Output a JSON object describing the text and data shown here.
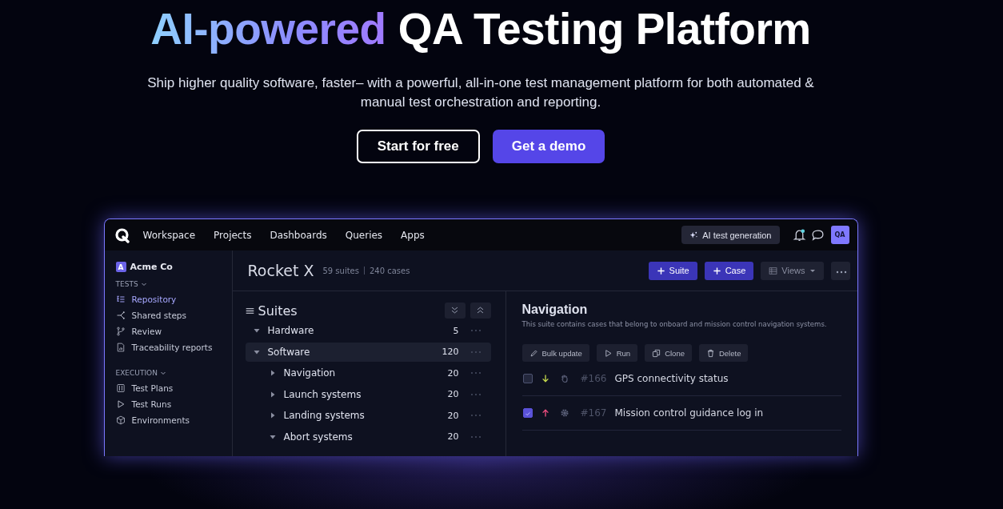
{
  "hero": {
    "title": [
      {
        "text": "AI-powered",
        "kind": "gradient"
      },
      {
        "text": "QA Testing Platform",
        "kind": "plain"
      }
    ],
    "subtitle": "Ship higher quality software, faster– with a powerful, all-in-one test management platform for both automated & manual test orchestration and reporting.",
    "buttons": [
      {
        "label": "Start for free",
        "kind": "outline"
      },
      {
        "label": "Get a demo",
        "kind": "primary"
      }
    ]
  },
  "app": {
    "nav": [
      "Workspace",
      "Projects",
      "Dashboards",
      "Queries",
      "Apps"
    ],
    "ai_button": "AI test generation",
    "notification": true,
    "avatar": "QA",
    "workspace": {
      "badge": "A",
      "name": "Acme Co"
    },
    "sidebar": [
      {
        "title": "TESTS",
        "expanded": true,
        "items": [
          {
            "label": "Repository",
            "selected": true
          },
          {
            "label": "Shared steps",
            "selected": false
          },
          {
            "label": "Review",
            "selected": false
          },
          {
            "label": "Traceability reports",
            "selected": false
          }
        ]
      },
      {
        "title": "EXECUTION",
        "expanded": true,
        "items": [
          {
            "label": "Test Plans",
            "selected": false
          },
          {
            "label": "Test Runs",
            "selected": false
          },
          {
            "label": "Environments",
            "selected": false
          }
        ]
      }
    ],
    "project": {
      "title": "Rocket X",
      "suites": "59 suites",
      "cases": "240 cases"
    },
    "toolbar": [
      {
        "label": "Suite",
        "kind": "primary"
      },
      {
        "label": "Case",
        "kind": "primary"
      },
      {
        "label": "Views",
        "kind": "dropdown"
      }
    ],
    "suites_title": "Suites",
    "tree": [
      {
        "label": "Hardware",
        "count": "5",
        "expanded": true,
        "selected": false
      },
      {
        "label": "Software",
        "count": "120",
        "expanded": true,
        "selected": true,
        "children": [
          {
            "label": "Navigation",
            "count": "20",
            "expanded": false,
            "selected": false
          },
          {
            "label": "Launch systems",
            "count": "20",
            "expanded": false,
            "selected": false
          },
          {
            "label": "Landing systems",
            "count": "20",
            "expanded": false,
            "selected": false
          },
          {
            "label": "Abort systems",
            "count": "20",
            "expanded": true,
            "selected": false
          }
        ]
      }
    ],
    "detail": {
      "title": "Navigation",
      "description": "This suite contains cases that belong to onboard and mission control navigation systems.",
      "actions": [
        "Bulk update",
        "Run",
        "Clone",
        "Delete"
      ],
      "cases": [
        {
          "id": "#166",
          "title": "GPS connectivity status",
          "checked": false,
          "kind": "low"
        },
        {
          "id": "#167",
          "title": "Mission control guidance log in",
          "checked": true,
          "kind": "high"
        }
      ]
    }
  }
}
